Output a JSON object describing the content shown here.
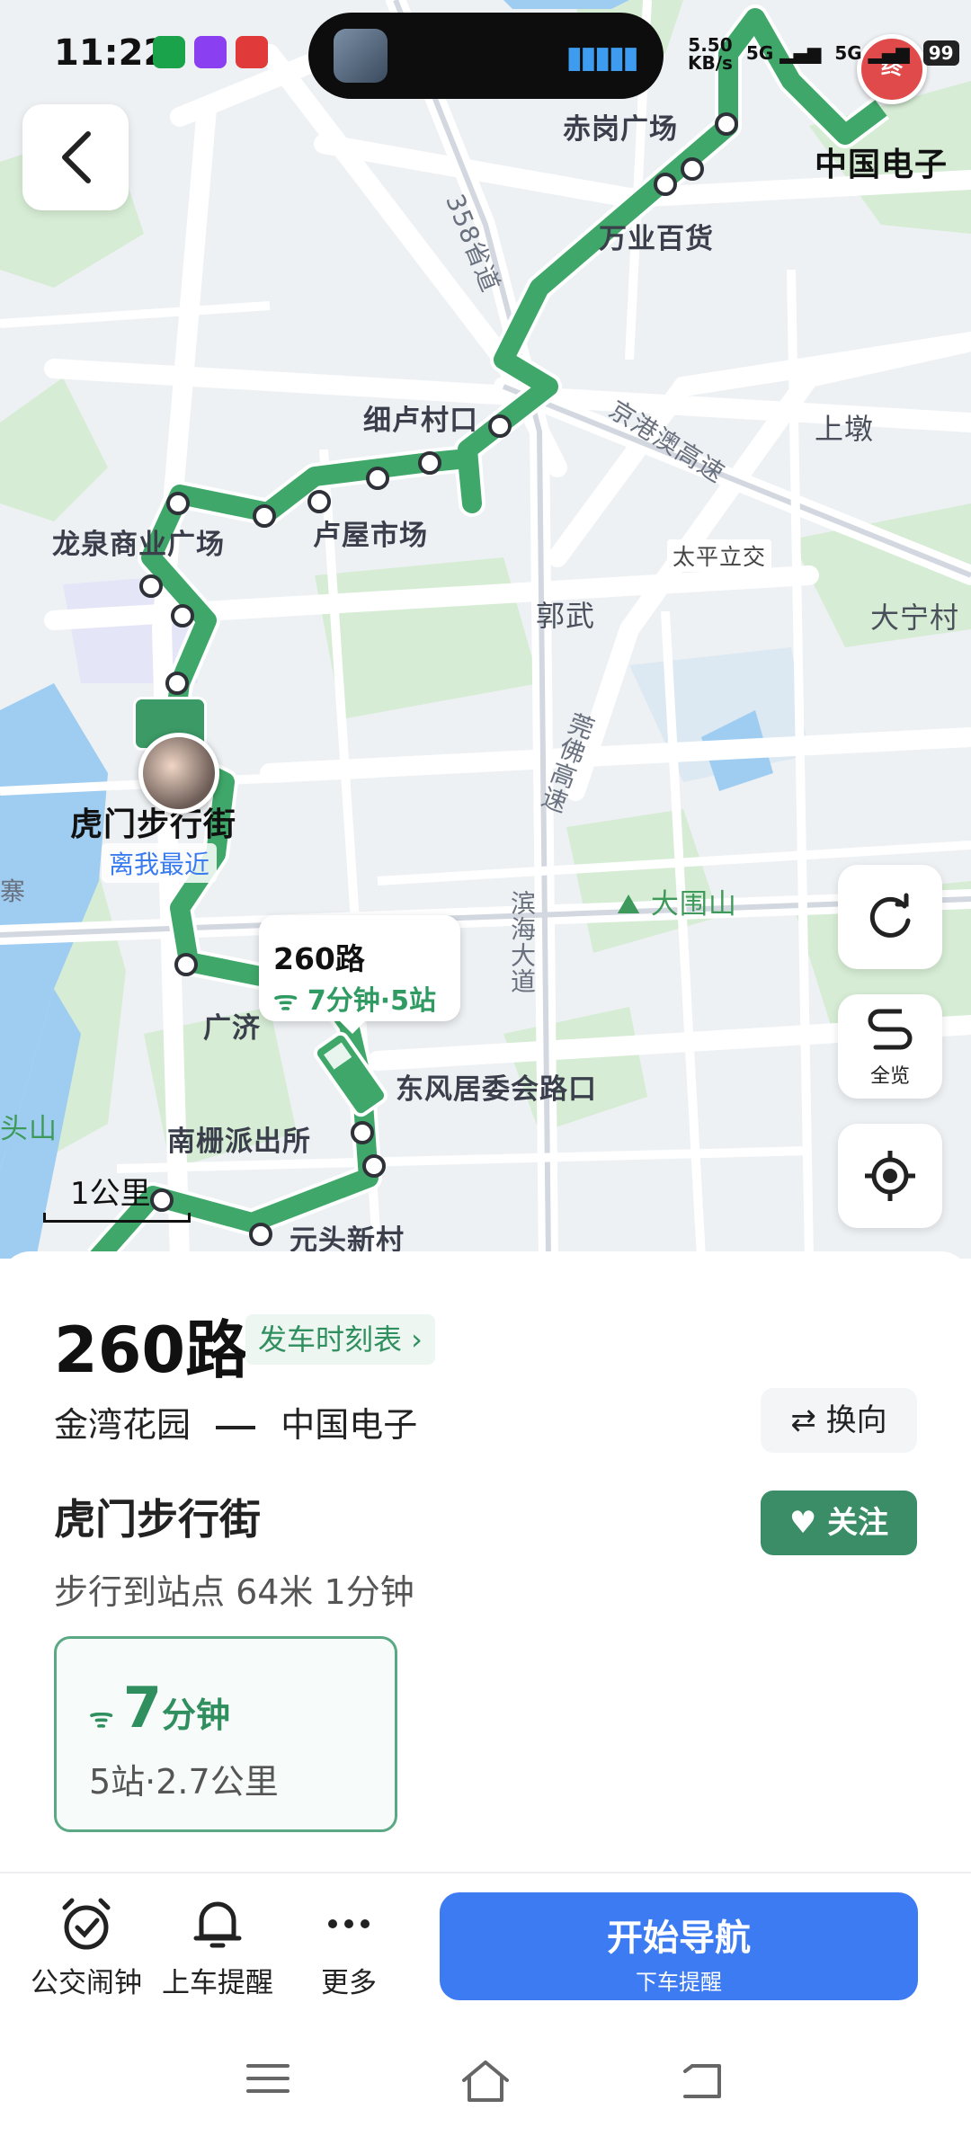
{
  "status_bar": {
    "time": "11:22",
    "speed": "5.50\nKB/s",
    "speed_value": "5.50",
    "speed_unit": "KB/s",
    "net1": "5G",
    "net2": "5G",
    "battery": "99"
  },
  "map": {
    "labels": {
      "chigang": "赤岗广场",
      "wanye": "万业百货",
      "xilu": "细卢村口",
      "shangdun": "上墩",
      "longquan": "龙泉商业广场",
      "luwu": "卢屋市场",
      "taiping_junction": "太平立交",
      "guowu": "郭武",
      "daning": "大宁村",
      "humen": "虎门步行街",
      "dawei_shan": "大围山",
      "guangji": "广济",
      "dongfeng": "东风居委会路口",
      "nanzha": "南栅派出所",
      "yuantou": "元头新村",
      "zhongguo_dianzi": "中国电子",
      "binhai": "滨海大道",
      "guanfo": "莞佛高速",
      "jinggang": "京港澳高速",
      "s358": "358省道",
      "zhai": "寨",
      "tou_shan": "头山"
    },
    "nearest": "离我最近",
    "scale": "1公里",
    "bus_tip": {
      "route": "260路",
      "eta": "7分钟·5站"
    },
    "end_badge": "终"
  },
  "controls": {
    "refresh": "刷新",
    "overview": "全览",
    "locate": "定位"
  },
  "panel": {
    "route_name": "260路",
    "timetable_link": "发车时刻表 ›",
    "from": "金湾花园",
    "to": "中国电子",
    "switch_label": "换向",
    "stop": "虎门步行街",
    "follow_label": "关注",
    "walk_info": "步行到站点 64米 1分钟",
    "arrival": {
      "minutes": "7",
      "unit": "分钟",
      "detail": "5站·2.7公里"
    }
  },
  "actions": {
    "alarm": "公交闹钟",
    "remind": "上车提醒",
    "more": "更多"
  },
  "navigate": {
    "title": "开始导航",
    "subtitle": "下车提醒"
  },
  "colors": {
    "route": "#3fa769",
    "accent_green": "#3a8d66",
    "nav_blue": "#3d7bf2"
  }
}
